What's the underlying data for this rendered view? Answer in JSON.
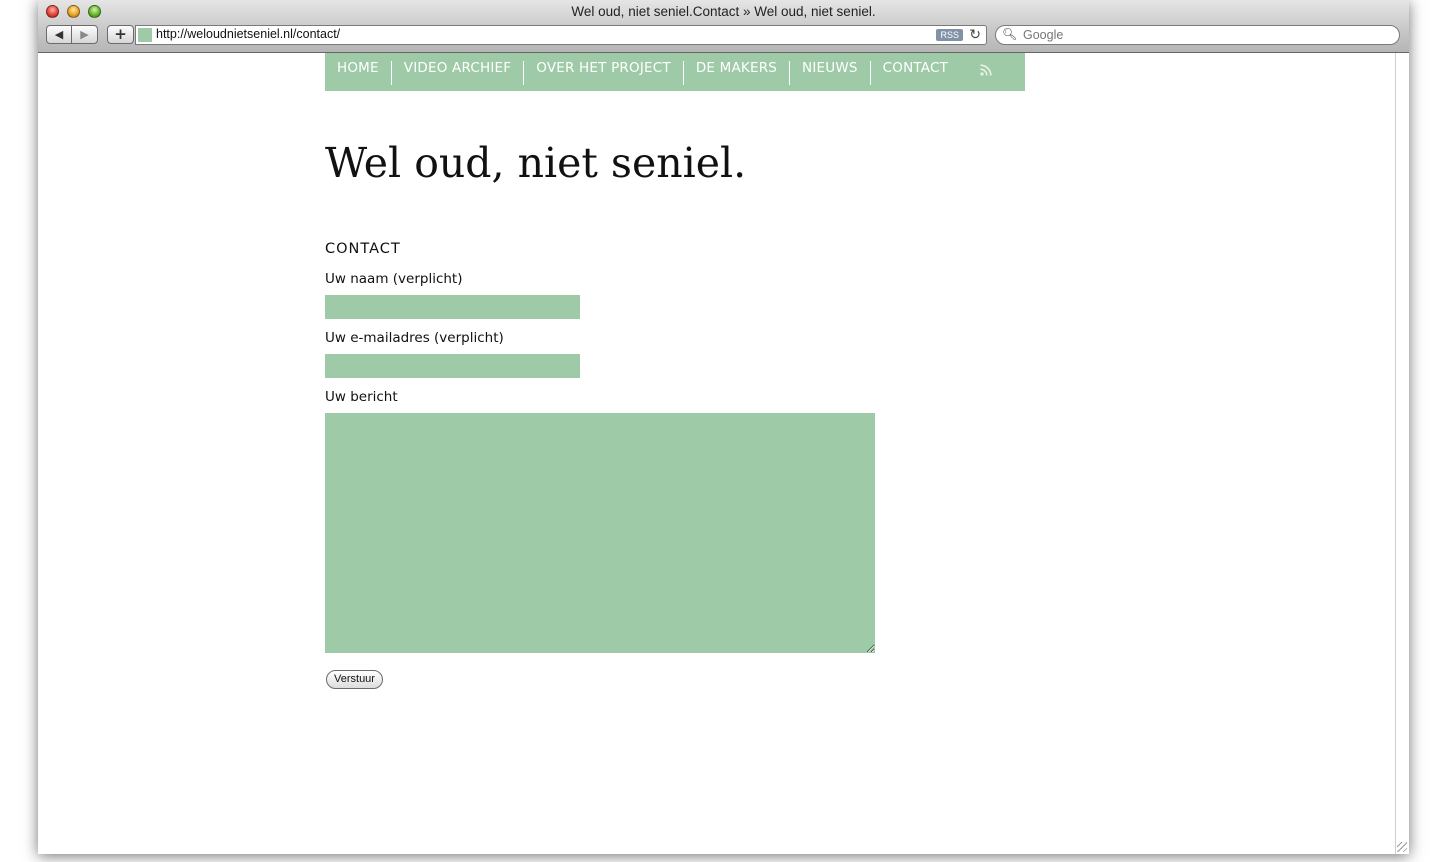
{
  "browser": {
    "window_title": "Wel oud, niet seniel.Contact » Wel oud, niet seniel.",
    "back_glyph": "◀",
    "forward_glyph": "▶",
    "add_glyph": "+",
    "url": "http://weloudnietseniel.nl/contact/",
    "rss_badge": "RSS",
    "reload_glyph": "↻",
    "search_placeholder": "Google",
    "search_glyph": "🔍︎"
  },
  "menu": {
    "items": [
      {
        "label": "HOME"
      },
      {
        "label": "VIDEO ARCHIEF"
      },
      {
        "label": "OVER HET PROJECT"
      },
      {
        "label": "DE MAKERS"
      },
      {
        "label": "NIEUWS"
      },
      {
        "label": "CONTACT"
      }
    ],
    "rss_icon": "rss-feed-icon",
    "color": "#9fcaa7"
  },
  "site": {
    "title": "Wel oud, niet seniel."
  },
  "contact": {
    "heading": "CONTACT",
    "name_label": "Uw naam (verplicht)",
    "name_value": "",
    "email_label": "Uw e-mailadres (verplicht)",
    "email_value": "",
    "message_label": "Uw bericht",
    "message_value": "",
    "submit_label": "Verstuur"
  }
}
